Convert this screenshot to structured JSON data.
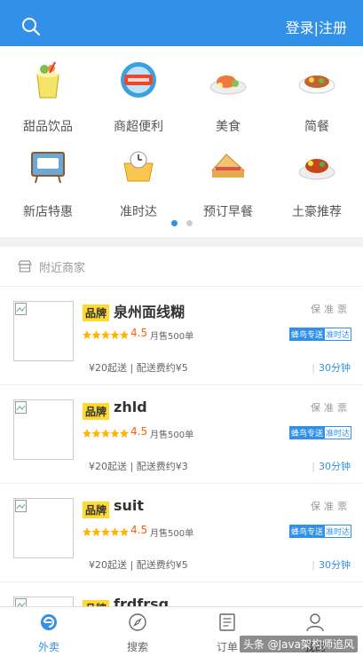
{
  "header": {
    "login_label": "登录|注册",
    "search_icon": "search-icon",
    "color": "#3190e8"
  },
  "categories": [
    {
      "label": "甜品饮品",
      "icon": "drink-icon"
    },
    {
      "label": "商超便利",
      "icon": "supermarket-icon"
    },
    {
      "label": "美食",
      "icon": "food-plate-icon"
    },
    {
      "label": "简餐",
      "icon": "simple-meal-icon"
    },
    {
      "label": "新店特惠",
      "icon": "new-store-icon"
    },
    {
      "label": "准时达",
      "icon": "on-time-icon"
    },
    {
      "label": "预订早餐",
      "icon": "breakfast-icon"
    },
    {
      "label": "土豪推荐",
      "icon": "recommend-icon"
    }
  ],
  "carousel": {
    "pages": 2,
    "active": 0
  },
  "nearby": {
    "title": "附近商家",
    "shops": [
      {
        "brand": "品牌",
        "name": "泉州面线糊",
        "tags": "保准票",
        "rating": "4.5",
        "sales": "月售500单",
        "badge_primary": "蜂鸟专送",
        "badge_secondary": "准时达",
        "fee": "¥20起送 | 配送费约¥5",
        "time": "30分钟"
      },
      {
        "brand": "品牌",
        "name": "zhld",
        "tags": "保准票",
        "rating": "4.5",
        "sales": "月售500单",
        "badge_primary": "蜂鸟专送",
        "badge_secondary": "准时达",
        "fee": "¥20起送 | 配送费约¥3",
        "time": "30分钟"
      },
      {
        "brand": "品牌",
        "name": "suit",
        "tags": "保准票",
        "rating": "4.5",
        "sales": "月售500单",
        "badge_primary": "蜂鸟专送",
        "badge_secondary": "准时达",
        "fee": "¥20起送 | 配送费约¥5",
        "time": "30分钟"
      },
      {
        "brand": "品牌",
        "name": "frdfrsg",
        "tags": "",
        "rating": "",
        "sales": "",
        "badge_primary": "",
        "badge_secondary": "",
        "fee": "",
        "time": ""
      }
    ]
  },
  "tabbar": [
    {
      "label": "外卖",
      "icon": "takeout-icon",
      "active": true
    },
    {
      "label": "搜索",
      "icon": "compass-icon",
      "active": false
    },
    {
      "label": "订单",
      "icon": "order-icon",
      "active": false
    },
    {
      "label": "我的",
      "icon": "profile-icon",
      "active": false
    }
  ],
  "watermark": "头条 @Java架构师追风"
}
